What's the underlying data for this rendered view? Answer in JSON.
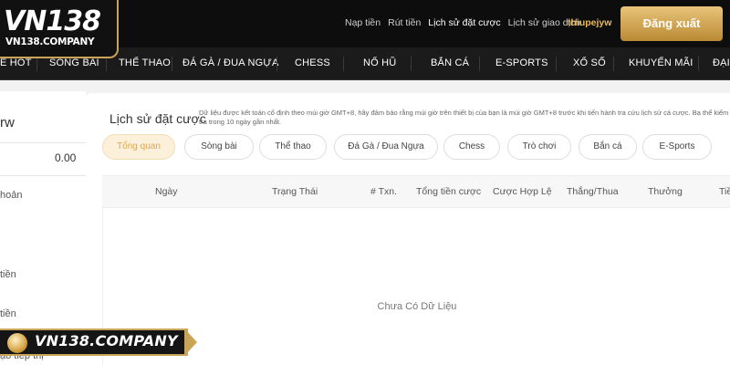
{
  "header": {
    "logo_text": "VN138",
    "logo_sub": "VN138.COMPANY",
    "links": [
      "Nạp tiền",
      "Rút tiền",
      "Lịch sử đặt cược",
      "Lịch sử giao dịch"
    ],
    "username": "thiupejyw",
    "logout_label": "Đăng xuất"
  },
  "nav": [
    "E HOT",
    "SÒNG BÀI",
    "THỂ THAO",
    "ĐÁ GÀ / ĐUA NGỰA",
    "CHESS",
    "NỔ HŨ",
    "BẮN CÁ",
    "E-SPORTS",
    "XỔ SỐ",
    "KHUYẾN MÃI",
    "ĐẠI"
  ],
  "sidebar": {
    "partial_name": "rw",
    "balance": "0.00",
    "items": [
      "hoản",
      "tiền",
      "tiền",
      "ạo tiếp thị"
    ]
  },
  "main": {
    "title": "Lịch sử đặt cược",
    "note": "Dữ liệu được kết toán cố định theo múi giờ GMT+8, hãy đảm bảo rằng múi giờ trên thiết bị của bạn là múi giờ GMT+8 trước khi tiến hành tra cứu lịch sử cá cược. Bạ thể kiểm tra trong 10 ngày gần nhất.",
    "tabs": [
      "Tổng quan",
      "Sòng bài",
      "Thể thao",
      "Đá Gà / Đua Ngựa",
      "Chess",
      "Trò chơi",
      "Bắn cá",
      "E-Sports"
    ],
    "columns": [
      "Ngày",
      "Trạng Thái",
      "# Txn.",
      "Tổng tiền cược",
      "Cược Hợp Lệ",
      "Thắng/Thua",
      "Thưởng",
      "Tiề"
    ],
    "empty_text": "Chưa Có Dữ Liệu"
  },
  "watermark": {
    "text": "VN138.COMPANY"
  },
  "colors": {
    "gold": "#c9a55a",
    "active_tab_bg": "#fdf0db",
    "active_tab_text": "#d9a84e"
  }
}
